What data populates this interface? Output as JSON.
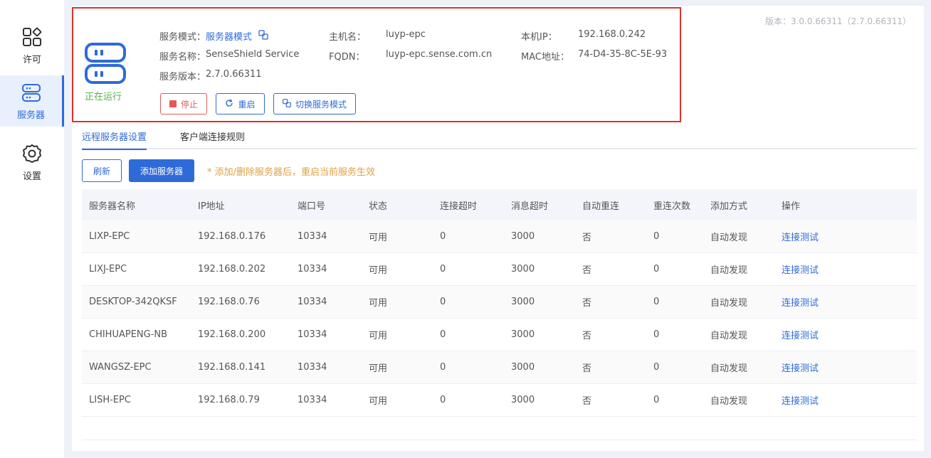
{
  "sidebar": {
    "items": [
      {
        "label": "许可",
        "icon": "apps-icon"
      },
      {
        "label": "服务器",
        "icon": "server-icon",
        "active": true
      },
      {
        "label": "设置",
        "icon": "gear-icon"
      }
    ]
  },
  "version": "版本：3.0.0.66311（2.7.0.66311）",
  "status": {
    "running_text": "正在运行",
    "service_mode_label": "服务模式：",
    "service_mode_value": "服务器模式",
    "service_name_label": "服务名称：",
    "service_name_value": "SenseShield Service",
    "service_version_label": "服务版本：",
    "service_version_value": "2.7.0.66311",
    "hostname_label": "主机名：",
    "hostname_value": "luyp-epc",
    "fqdn_label": "FQDN：",
    "fqdn_value": "luyp-epc.sense.com.cn",
    "ip_label": "本机IP：",
    "ip_value": "192.168.0.242",
    "mac_label": "MAC地址：",
    "mac_value": "74-D4-35-8C-5E-93",
    "stop_label": "停止",
    "restart_label": "重启",
    "switch_label": "切换服务模式"
  },
  "tabs": [
    {
      "label": "远程服务器设置",
      "active": true
    },
    {
      "label": "客户端连接规则"
    }
  ],
  "toolbar": {
    "refresh_label": "刷新",
    "add_label": "添加服务器",
    "hint": "* 添加/删除服务器后，重启当前服务生效"
  },
  "table": {
    "columns": [
      "服务器名称",
      "IP地址",
      "端口号",
      "状态",
      "连接超时",
      "消息超时",
      "自动重连",
      "重连次数",
      "添加方式",
      "操作"
    ],
    "rows": [
      [
        "LIXP-EPC",
        "192.168.0.176",
        "10334",
        "可用",
        "0",
        "3000",
        "否",
        "0",
        "自动发现",
        "连接测试"
      ],
      [
        "LIXJ-EPC",
        "192.168.0.202",
        "10334",
        "可用",
        "0",
        "3000",
        "否",
        "0",
        "自动发现",
        "连接测试"
      ],
      [
        "DESKTOP-342QKSF",
        "192.168.0.76",
        "10334",
        "可用",
        "0",
        "3000",
        "否",
        "0",
        "自动发现",
        "连接测试"
      ],
      [
        "CHIHUAPENG-NB",
        "192.168.0.200",
        "10334",
        "可用",
        "0",
        "3000",
        "否",
        "0",
        "自动发现",
        "连接测试"
      ],
      [
        "WANGSZ-EPC",
        "192.168.0.141",
        "10334",
        "可用",
        "0",
        "3000",
        "否",
        "0",
        "自动发现",
        "连接测试"
      ],
      [
        "LISH-EPC",
        "192.168.0.79",
        "10334",
        "可用",
        "0",
        "3000",
        "否",
        "0",
        "自动发现",
        "连接测试"
      ]
    ]
  },
  "colors": {
    "accent": "#2f6bd8",
    "running": "#58b24a",
    "stop": "#e05a5a",
    "hint": "#e0a040",
    "highlight_border": "#d9342b"
  }
}
